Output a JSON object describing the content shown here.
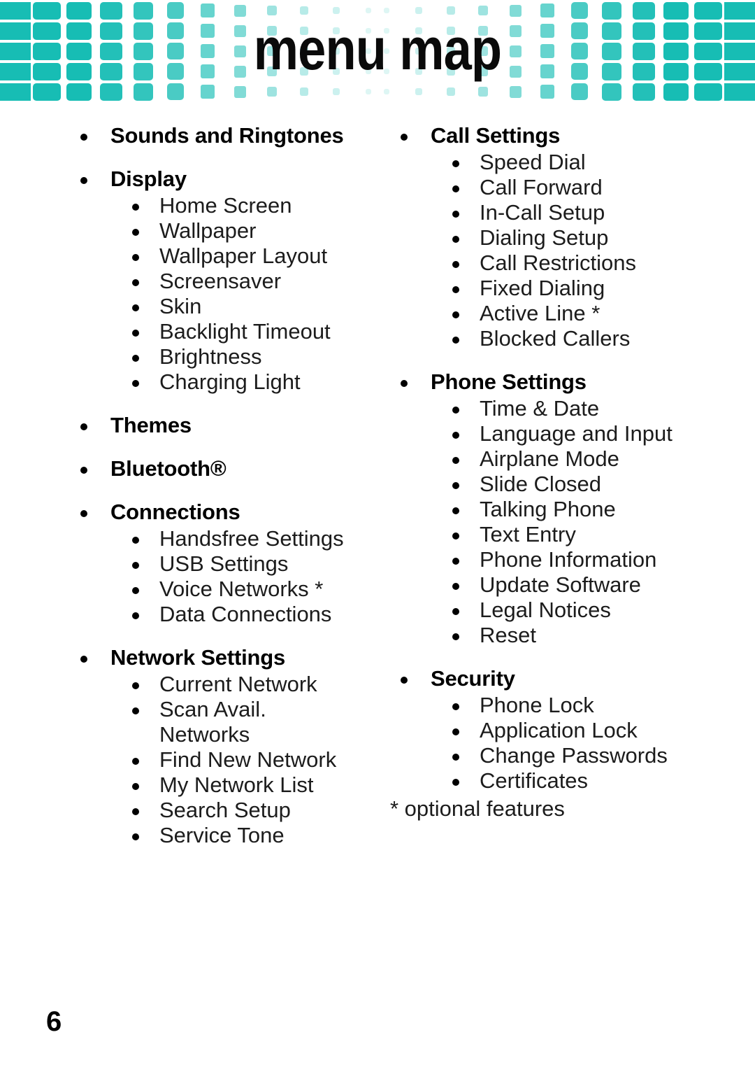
{
  "header": {
    "title": "menu map",
    "accent_color": "#17bdb4",
    "pattern_rows": 5,
    "pattern_columns": 11
  },
  "page_number": "6",
  "footnote": "* optional features",
  "columns": {
    "left": [
      {
        "label": "Sounds and Ringtones",
        "items": []
      },
      {
        "label": "Display",
        "items": [
          "Home Screen",
          "Wallpaper",
          "Wallpaper Layout",
          "Screensaver",
          "Skin",
          "Backlight Timeout",
          "Brightness",
          "Charging Light"
        ]
      },
      {
        "label": "Themes",
        "items": []
      },
      {
        "label": "Bluetooth®",
        "items": []
      },
      {
        "label": "Connections",
        "items": [
          "Handsfree Settings",
          "USB Settings",
          "Voice Networks *",
          "Data Connections"
        ]
      },
      {
        "label": "Network Settings",
        "items": [
          "Current Network",
          "Scan Avail.",
          "Networks",
          "Find New Network",
          "My Network List",
          "Search Setup",
          "Service Tone"
        ]
      }
    ],
    "right": [
      {
        "label": "Call Settings",
        "items": [
          "Speed Dial",
          "Call Forward",
          "In-Call Setup",
          "Dialing Setup",
          "Call Restrictions",
          "Fixed Dialing",
          "Active Line *",
          "Blocked Callers"
        ]
      },
      {
        "label": "Phone Settings",
        "items": [
          "Time & Date",
          "Language and Input",
          "Airplane Mode",
          "Slide Closed",
          "Talking Phone",
          "Text Entry",
          "Phone Information",
          "Update Software",
          "Legal Notices",
          "Reset"
        ]
      },
      {
        "label": "Security",
        "items": [
          "Phone Lock",
          "Application Lock",
          "Change Passwords",
          "Certificates"
        ]
      }
    ]
  }
}
